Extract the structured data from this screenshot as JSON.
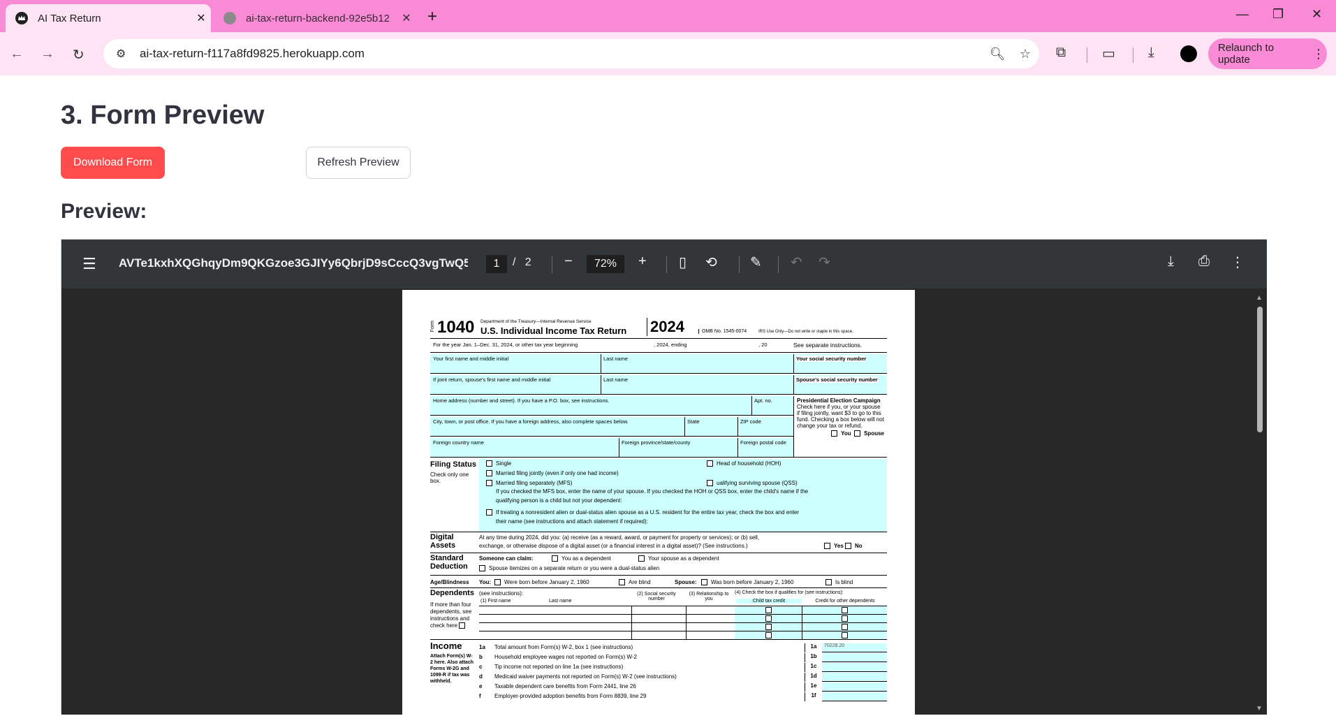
{
  "browser": {
    "tabs": [
      {
        "title": "AI Tax Return",
        "active": true
      },
      {
        "title": "ai-tax-return-backend-92e5b12",
        "active": false
      }
    ],
    "url": "ai-tax-return-f117a8fd9825.herokuapp.com",
    "relaunch_label": "Relaunch to update"
  },
  "main": {
    "heading": "3. Form Preview",
    "download_label": "Download Form",
    "refresh_label": "Refresh Preview",
    "preview_heading": "Preview:"
  },
  "pdf_viewer": {
    "filename": "AVTe1kxhXQGhqyDm9QKGzoe3GJIYy6QbrjD9sCccQ3vgTwQ5...",
    "page_current": "1",
    "page_separator": "/",
    "page_total": "2",
    "zoom": "72%"
  },
  "form": {
    "form_label": "Form",
    "number": "1040",
    "dept": "Department of the Treasury—Internal Revenue Service",
    "title": "U.S. Individual Income Tax Return",
    "year": "2024",
    "omb": "OMB No. 1545-0074",
    "irs_use": "IRS Use Only—Do not write or staple in this space.",
    "year_line": "For the year Jan. 1–Dec. 31, 2024, or other tax year beginning",
    "year_line_mid": ", 2024, ending",
    "year_line_end": ", 20",
    "see_sep": "See separate instructions.",
    "first_name": "Your first name and middle initial",
    "last_name": "Last name",
    "ssn": "Your social security number",
    "spouse_first": "If joint return, spouse's first name and middle initial",
    "spouse_last": "Last name",
    "spouse_ssn": "Spouse's social security number",
    "home_addr": "Home address (number and street). If you have a P.O. box, see instructions.",
    "apt": "Apt. no.",
    "pec_title": "Presidential Election Campaign",
    "pec_text": "Check here if you, or your spouse if filing jointly, want $3 to go to this fund. Checking a box below will not change your tax or refund.",
    "pec_you": "You",
    "pec_spouse": "Spouse",
    "city": "City, town, or post office. If you have a foreign address, also complete spaces below.",
    "state": "State",
    "zip": "ZIP code",
    "foreign_country": "Foreign country name",
    "foreign_prov": "Foreign province/state/county",
    "foreign_postal": "Foreign postal code",
    "filing_status": "Filing Status",
    "check_only": "Check only one box.",
    "fs_single": "Single",
    "fs_mfj": "Married filing jointly (even if only one had income)",
    "fs_mfs": "Married filing separately (MFS)",
    "fs_hoh": "Head of household (HOH)",
    "fs_qss": "ualifying surviving spouse (QSS)",
    "fs_note1": "If you checked the MFS box, enter the name of your spouse. If you checked the HOH or QSS box, enter the child's name if the",
    "fs_note2": "qualifying person is a child but not your dependent:",
    "fs_nra1": "If treating a nonresident alien or dual-status alien spouse as a U.S. resident for the entire tax year, check the box and enter",
    "fs_nra2": "their name (see instructions and attach statement if required):",
    "digital": "Digital Assets",
    "digital_q1": "At any time during 2024, did you: (a) receive (as a reward, award, or payment for property or services); or (b) sell,",
    "digital_q2": "exchange, or otherwise dispose of a digital asset (or a financial interest in a digital asset)? (See instructions.)",
    "yes": "Yes",
    "no": "No",
    "std_ded": "Standard Deduction",
    "someone_claim": "Someone can claim:",
    "you_dep": "You as a dependent",
    "spouse_dep": "Your spouse as a dependent",
    "spouse_itemizes": "Spouse itemizes on a separate return or you were a dual-status alien",
    "age_blind": "Age/Blindness",
    "you_label": "You:",
    "born_before": "Were born before January 2, 1960",
    "are_blind": "Are blind",
    "spouse_label": "Spouse:",
    "was_born": "Was born before January 2, 1960",
    "is_blind": "Is blind",
    "dependents": "Dependents",
    "see_instr": "(see instructions):",
    "dep_first": "(1) First name",
    "dep_last": "Last name",
    "dep_ssn": "(2) Social security number",
    "dep_rel": "(3) Relationship to you",
    "dep_check": "(4) Check the box if qualifies for (see instructions):",
    "dep_ctc": "Child tax credit",
    "dep_odc": "Credit for other dependents",
    "dep_more": "If more than four dependents, see instructions and check here",
    "income": "Income",
    "attach": "Attach Form(s) W-2 here. Also attach Forms W-2G and 1099-R if tax was withheld.",
    "lines": [
      {
        "n": "1a",
        "t": "Total amount from Form(s) W-2, box 1 (see instructions)",
        "box": "1a",
        "val": "70228.20"
      },
      {
        "n": "b",
        "t": "Household employee wages not reported on Form(s) W-2",
        "box": "1b",
        "val": ""
      },
      {
        "n": "c",
        "t": "Tip income not reported on line 1a (see instructions)",
        "box": "1c",
        "val": ""
      },
      {
        "n": "d",
        "t": "Medicaid waiver payments not reported on Form(s) W-2 (see instructions)",
        "box": "1d",
        "val": ""
      },
      {
        "n": "e",
        "t": "Taxable dependent care benefits from Form 2441, line 26",
        "box": "1e",
        "val": ""
      },
      {
        "n": "f",
        "t": "Employer-provided adoption benefits from Form 8839, line 29",
        "box": "1f",
        "val": ""
      }
    ]
  }
}
